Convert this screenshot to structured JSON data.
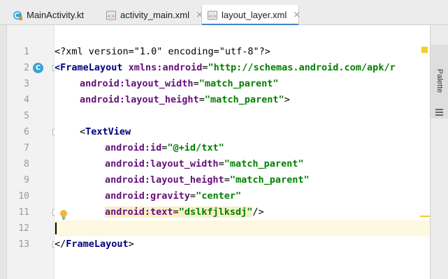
{
  "tabs": [
    {
      "label": "MainActivity.kt",
      "icon": "kotlin-class-icon",
      "active": false
    },
    {
      "label": "activity_main.xml",
      "icon": "xml-file-icon",
      "active": false
    },
    {
      "label": "layout_layer.xml",
      "icon": "xml-file-icon",
      "active": true
    }
  ],
  "close_glyph": "×",
  "gutter": {
    "line_numbers": [
      "1",
      "2",
      "3",
      "4",
      "5",
      "6",
      "7",
      "8",
      "9",
      "10",
      "11",
      "12",
      "13"
    ],
    "class_badge": "C"
  },
  "code": {
    "l1": {
      "text": "<?xml version=\"1.0\" encoding=\"utf-8\"?>"
    },
    "l2": {
      "tag": "<FrameLayout ",
      "attr": "xmlns:android",
      "eq": "=",
      "val": "\"http://schemas.android.com/apk/r"
    },
    "l3": {
      "attr": "android:layout_width",
      "eq": "=",
      "val": "\"match_parent\""
    },
    "l4": {
      "attr": "android:layout_height",
      "eq": "=",
      "val": "\"match_parent\"",
      "end": ">"
    },
    "l6": {
      "open": "<",
      "tag": "TextView"
    },
    "l7": {
      "attr": "android:id",
      "eq": "=",
      "val": "\"@+id/txt\""
    },
    "l8": {
      "attr": "android:layout_width",
      "eq": "=",
      "val": "\"match_parent\""
    },
    "l9": {
      "attr": "android:layout_height",
      "eq": "=",
      "val": "\"match_parent\""
    },
    "l10": {
      "attr": "android:gravity",
      "eq": "=",
      "val": "\"center\""
    },
    "l11": {
      "attr": "android:text",
      "eq": "=",
      "val": "\"dslkfjlksdj\"",
      "end": "/>"
    },
    "l13": {
      "open": "</",
      "tag": "FrameLayout",
      "end": ">"
    }
  },
  "palette": {
    "label": "Palette"
  },
  "colors": {
    "tag": "#000080",
    "attribute": "#660e7a",
    "value": "#008000",
    "accent": "#4083c9",
    "warning": "#f0cf2e"
  }
}
